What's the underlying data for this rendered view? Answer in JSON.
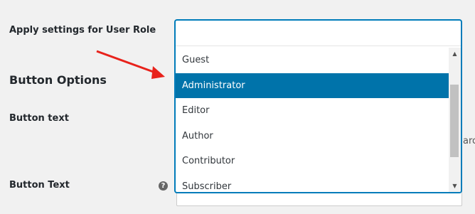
{
  "form": {
    "role_label": "Apply settings for User Role",
    "section_title": "Button Options",
    "button_text_label": "Button text",
    "button_text_field_label": "Button Text",
    "help_icon": "question-circle-icon",
    "cut_off_text": "arc"
  },
  "role_select": {
    "options": [
      "Guest",
      "Administrator",
      "Editor",
      "Author",
      "Contributor",
      "Subscriber"
    ],
    "selected": "Administrator",
    "accent_color": "#0073aa"
  },
  "annotation": {
    "arrow_color": "#e8221b",
    "arrow_icon": "red-arrow-icon"
  }
}
